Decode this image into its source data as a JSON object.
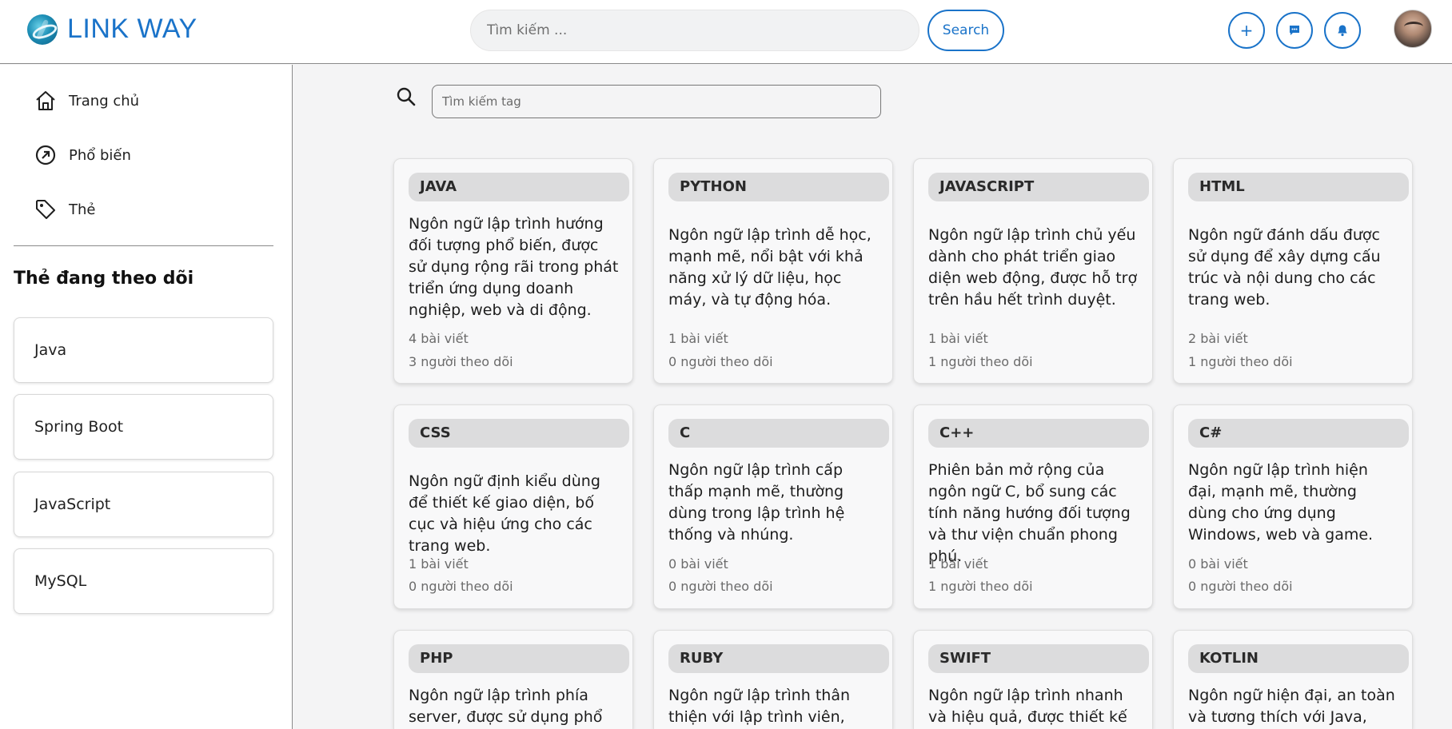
{
  "header": {
    "brand": "LINK WAY",
    "search_placeholder": "Tìm kiếm ...",
    "search_button": "Search"
  },
  "sidebar": {
    "nav": [
      {
        "label": "Trang chủ",
        "icon": "home-icon"
      },
      {
        "label": "Phổ biến",
        "icon": "trending-icon"
      },
      {
        "label": "Thẻ",
        "icon": "tag-icon"
      }
    ],
    "following_title": "Thẻ đang theo dõi",
    "following": [
      "Java",
      "Spring Boot",
      "JavaScript",
      "MySQL"
    ]
  },
  "main": {
    "tag_search_placeholder": "Tìm kiếm tag",
    "tags": [
      {
        "name": "JAVA",
        "description": "Ngôn ngữ lập trình hướng đối tượng phổ biến, được sử dụng rộng rãi trong phát triển ứng dụng doanh nghiệp, web và di động.",
        "posts": "4 bài viết",
        "followers": "3 người theo dõi"
      },
      {
        "name": "PYTHON",
        "description": "Ngôn ngữ lập trình dễ học, mạnh mẽ, nổi bật với khả năng xử lý dữ liệu, học máy, và tự động hóa.",
        "posts": "1 bài viết",
        "followers": "0 người theo dõi"
      },
      {
        "name": "JAVASCRIPT",
        "description": "Ngôn ngữ lập trình chủ yếu dành cho phát triển giao diện web động, được hỗ trợ trên hầu hết trình duyệt.",
        "posts": "1 bài viết",
        "followers": "1 người theo dõi"
      },
      {
        "name": "HTML",
        "description": "Ngôn ngữ đánh dấu được sử dụng để xây dựng cấu trúc và nội dung cho các trang web.",
        "posts": "2 bài viết",
        "followers": "1 người theo dõi"
      },
      {
        "name": "CSS",
        "description": "Ngôn ngữ định kiểu dùng để thiết kế giao diện, bố cục và hiệu ứng cho các trang web.",
        "posts": "1 bài viết",
        "followers": "0 người theo dõi"
      },
      {
        "name": "C",
        "description": "Ngôn ngữ lập trình cấp thấp mạnh mẽ, thường dùng trong lập trình hệ thống và nhúng.",
        "posts": "0 bài viết",
        "followers": "0 người theo dõi"
      },
      {
        "name": "C++",
        "description": "Phiên bản mở rộng của ngôn ngữ C, bổ sung các tính năng hướng đối tượng và thư viện chuẩn phong phú.",
        "posts": "1 bài viết",
        "followers": "1 người theo dõi"
      },
      {
        "name": "C#",
        "description": "Ngôn ngữ lập trình hiện đại, mạnh mẽ, thường dùng cho ứng dụng Windows, web và game.",
        "posts": "0 bài viết",
        "followers": "0 người theo dõi"
      },
      {
        "name": "PHP",
        "description": "Ngôn ngữ lập trình phía server, được sử dụng phổ",
        "posts": "",
        "followers": ""
      },
      {
        "name": "RUBY",
        "description": "Ngôn ngữ lập trình thân thiện với lập trình viên,",
        "posts": "",
        "followers": ""
      },
      {
        "name": "SWIFT",
        "description": "Ngôn ngữ lập trình nhanh và hiệu quả, được thiết kế riêng",
        "posts": "",
        "followers": ""
      },
      {
        "name": "KOTLIN",
        "description": "Ngôn ngữ hiện đại, an toàn và tương thích với Java, phổ",
        "posts": "",
        "followers": ""
      }
    ]
  },
  "colors": {
    "brand_blue": "#1a73c9",
    "page_bg": "#f4f4f5",
    "card_bg": "#f8f8f9",
    "tag_pill": "#dcdcdd"
  }
}
